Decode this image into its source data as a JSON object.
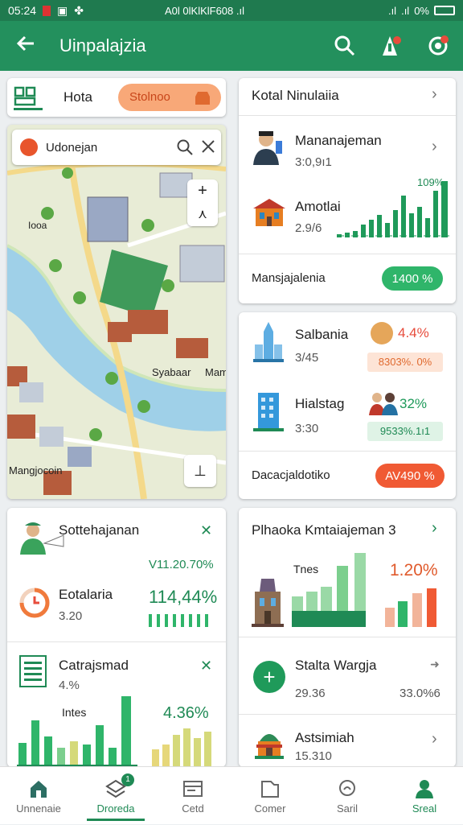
{
  "status_bar": {
    "time": "05:24",
    "center_text": "A0l 0lKlKlF608 .ıl",
    "battery": "0%"
  },
  "app_bar": {
    "title": "Uinpalajzia",
    "back_icon": "arrow-left-icon",
    "search_icon": "search-icon",
    "bell_icon": "notification-icon",
    "settings_icon": "settings-icon"
  },
  "colors": {
    "primary": "#23905d",
    "primary_dark": "#1f7a4f",
    "accent_orange": "#f27a3c",
    "green_pill": "#2fb56a"
  },
  "hota_card": {
    "tab_label": "Hota",
    "chip_label": "Stolnoo"
  },
  "map": {
    "search_text": "Udonejan",
    "labels": [
      "Iooa",
      "Syabaar",
      "Mam",
      "Mangjocoin"
    ]
  },
  "kotal_card": {
    "title": "Kotal Ninulaiia",
    "rows": [
      {
        "title": "Mananajeman",
        "value": "3:0,9ı1"
      },
      {
        "title": "Amotlai",
        "value": "2.9/6"
      }
    ],
    "chart_percent": "109%",
    "footer_label": "Mansjajalenia",
    "footer_pill": "1400 %"
  },
  "salbania_card": {
    "rows": [
      {
        "title": "Salbania",
        "value": "3/45",
        "percent": "4.4%",
        "badge": "8303%. 0%"
      },
      {
        "title": "Hialstag",
        "value": "3:30",
        "percent": "32%",
        "badge": "9533%.1ı1"
      }
    ],
    "footer_label": "Dacacjaldotiko",
    "footer_pill": "AV490 %"
  },
  "sottehajanan_card": {
    "title": "Sottehajanan",
    "value_top": "V11.20.70%",
    "row_title": "Eotalaria",
    "row_value": "3.20",
    "row_percent": "114,44%"
  },
  "catraj_card": {
    "title": "Catrajsmad",
    "value": "4.%",
    "chart_title": "Intes",
    "chart_percent": "4.36%"
  },
  "plhaoka_card": {
    "title": "Plhaoka Kmtaiajeman 3",
    "chart_title": "Tnes",
    "chart_percent": "1.20%",
    "rows": [
      {
        "title": "Stalta Wargja",
        "value_left": "29.36",
        "value_right": "33.0%6"
      },
      {
        "title": "Astsimiah",
        "value_left": "15.310"
      }
    ]
  },
  "bottom_nav": [
    {
      "label": "Unnenaie",
      "icon": "home-icon"
    },
    {
      "label": "Droreda",
      "icon": "map-icon",
      "badge": "1"
    },
    {
      "label": "Cetd",
      "icon": "card-icon"
    },
    {
      "label": "Comer",
      "icon": "folder-icon"
    },
    {
      "label": "Saril",
      "icon": "search-icon"
    },
    {
      "label": "Sreal",
      "icon": "profile-icon"
    }
  ]
}
